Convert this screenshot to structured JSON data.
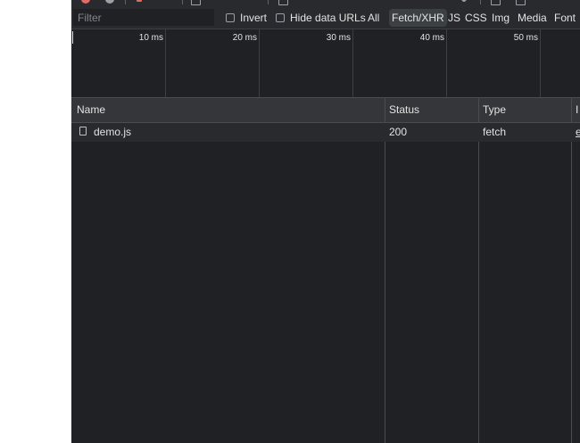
{
  "filter": {
    "placeholder": "Filter"
  },
  "options": {
    "invert_label": "Invert",
    "hide_data_urls_label": "Hide data URLs"
  },
  "type_filters": [
    "All",
    "Fetch/XHR",
    "JS",
    "CSS",
    "Img",
    "Media",
    "Font"
  ],
  "active_type_filter": "Fetch/XHR",
  "timeline": {
    "ticks": [
      "10 ms",
      "20 ms",
      "30 ms",
      "40 ms",
      "50 ms"
    ]
  },
  "table": {
    "columns": [
      "Name",
      "Status",
      "Type",
      "I"
    ],
    "rows": [
      {
        "name": "demo.js",
        "status": "200",
        "type": "fetch",
        "initiator": "e"
      }
    ]
  }
}
